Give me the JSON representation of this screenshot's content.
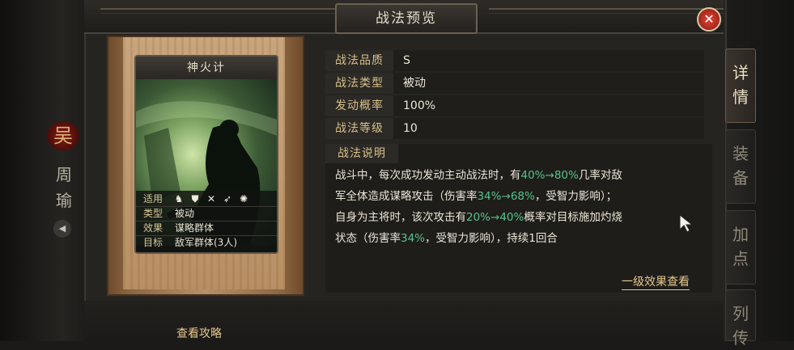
{
  "window": {
    "title": "战法预览"
  },
  "hero": {
    "faction_char": "吴",
    "name_chars": [
      "周",
      "瑜"
    ]
  },
  "card": {
    "name": "神火计",
    "rows": [
      {
        "label": "适用",
        "troop_icons": [
          "cavalry-icon",
          "shield-icon",
          "bow-icon",
          "spear-icon",
          "wheel-icon"
        ]
      },
      {
        "label": "类型",
        "value": "被动"
      },
      {
        "label": "效果",
        "value": "谋略群体"
      },
      {
        "label": "目标",
        "value": "敌军群体(3人)"
      }
    ]
  },
  "attributes": [
    {
      "label": "战法品质",
      "value": "S"
    },
    {
      "label": "战法类型",
      "value": "被动"
    },
    {
      "label": "发动概率",
      "value": "100%"
    },
    {
      "label": "战法等级",
      "value": "10"
    }
  ],
  "description": {
    "title": "战法说明",
    "lines": [
      {
        "parts": [
          {
            "t": "战斗中，每次成功发动主动战法时，有"
          },
          {
            "t": "40%→80%",
            "hl": true
          },
          {
            "t": "几率对敌"
          }
        ]
      },
      {
        "parts": [
          {
            "t": "军全体造成谋略攻击（伤害率"
          },
          {
            "t": "34%→68%",
            "hl": true
          },
          {
            "t": "，受智力影响）；"
          }
        ]
      },
      {
        "parts": [
          {
            "t": "自身为主将时，该次攻击有"
          },
          {
            "t": "20%→40%",
            "hl": true
          },
          {
            "t": "概率对目标施加灼烧"
          }
        ]
      },
      {
        "parts": [
          {
            "t": "状态（伤害率"
          },
          {
            "t": "34%",
            "hl": true
          },
          {
            "t": "，受智力影响），持续1回合"
          }
        ]
      }
    ],
    "highlight_color": "#57c48a"
  },
  "links": {
    "first_level_effect": "一级效果查看",
    "view_guide": "查看攻略"
  },
  "side_tabs": [
    {
      "label": "详情",
      "active": true
    },
    {
      "label": "装备",
      "active": false
    },
    {
      "label": "加点",
      "active": false
    },
    {
      "label": "列传",
      "active": false
    }
  ],
  "colors": {
    "label_gold": "#d8c08a",
    "close_red": "#c2301f",
    "scroll_wood": "#b89067"
  }
}
